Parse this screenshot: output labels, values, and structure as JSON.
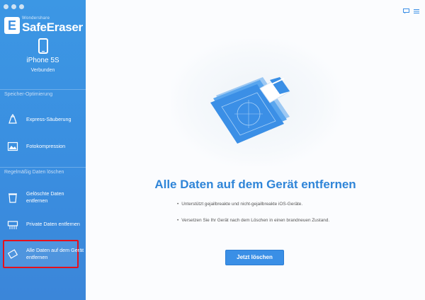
{
  "brand": {
    "subtitle": "Wondershare",
    "name": "SafeEraser",
    "logo_letter": "E"
  },
  "device": {
    "name": "iPhone 5S",
    "status": "Verbunden",
    "icon": "phone-icon"
  },
  "sidebar": {
    "sections": [
      {
        "label": "Speicher-Optimierung"
      },
      {
        "label": "Regelmäßig Daten löschen"
      }
    ],
    "items": [
      {
        "label": "Express-Säuberung",
        "icon": "broom-icon"
      },
      {
        "label": "Fotokompression",
        "icon": "photo-icon"
      },
      {
        "label": "Gelöschte Daten entfernen",
        "icon": "trash-icon"
      },
      {
        "label": "Private Daten entfernen",
        "icon": "shredder-icon"
      },
      {
        "label": "Alle Daten auf dem Gerät entfernen",
        "icon": "eraser-icon",
        "selected": true
      }
    ]
  },
  "main": {
    "headline": "Alle Daten auf dem Gerät entfernen",
    "bullets": [
      "Unterstützt gejailbreakte und nicht-gejailbreakte iOS-Geräte.",
      "Versetzen Sie Ihr Gerät nach dem Löschen in einen brandneuen Zustand."
    ],
    "button": "Jetzt löschen",
    "bullet_char": "•"
  },
  "colors": {
    "sidebar": "#3b8fe2",
    "accent": "#2f85d8",
    "highlight": "#e6101c",
    "button": "#3a8fe6"
  }
}
